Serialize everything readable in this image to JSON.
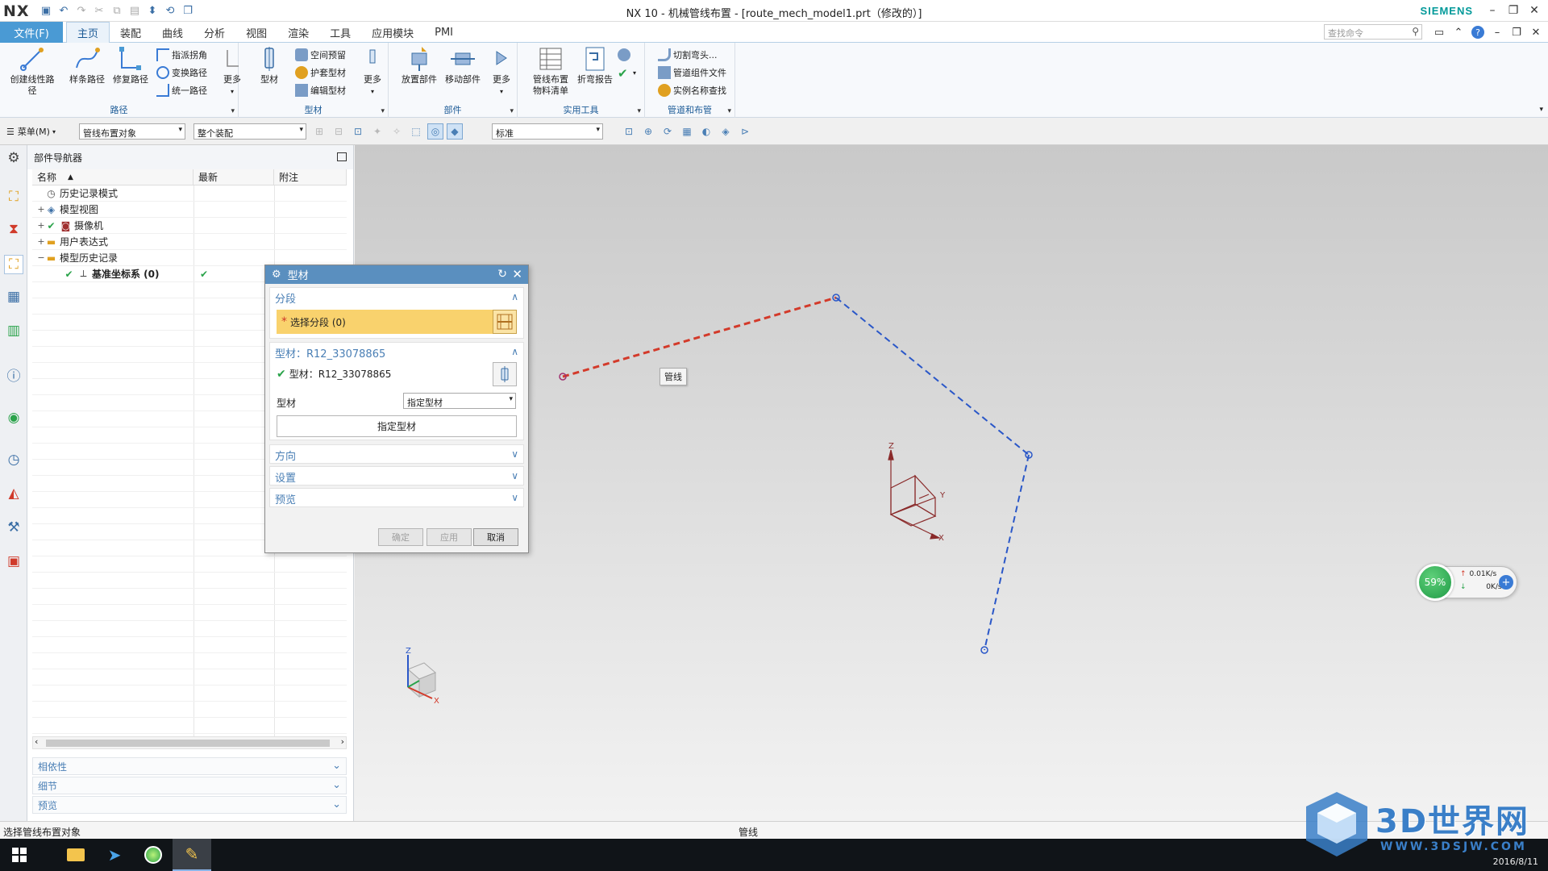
{
  "window": {
    "title": "NX 10 - 机械管线布置 - [route_mech_model1.prt（修改的）]",
    "brand": "SIEMENS",
    "app_logo": "NX"
  },
  "menubar": {
    "file_label": "文件(F)",
    "tabs": [
      "主页",
      "装配",
      "曲线",
      "分析",
      "视图",
      "渲染",
      "工具",
      "应用模块",
      "PMI"
    ],
    "active_tab": "主页",
    "search_placeholder": "查找命令"
  },
  "ribbon": {
    "groups": [
      {
        "name": "路径",
        "big": [
          "创建线性路径",
          "样条路径",
          "修复路径"
        ],
        "small": [
          "指派拐角",
          "变换路径",
          "统一路径"
        ],
        "more": "更多"
      },
      {
        "name": "型材",
        "big": [
          "型材"
        ],
        "small": [
          "空间预留",
          "护套型材",
          "编辑型材"
        ],
        "more": "更多"
      },
      {
        "name": "部件",
        "big": [
          "放置部件",
          "移动部件"
        ],
        "more": "更多"
      },
      {
        "name": "实用工具",
        "big": [
          "管线布置物料清单",
          "折弯报告"
        ]
      },
      {
        "name": "管道和布管",
        "small": [
          "切割弯头...",
          "管道组件文件",
          "实例名称查找"
        ]
      }
    ]
  },
  "selection_bar": {
    "menu_label": "菜单(M)",
    "filter": "管线布置对象",
    "scope": "整个装配",
    "render_style": "标准"
  },
  "navigator": {
    "title": "部件导航器",
    "columns": [
      "名称",
      "最新",
      "附注"
    ],
    "rows": [
      {
        "name": "历史记录模式",
        "icon": "clock-icon",
        "expand": "",
        "latest": ""
      },
      {
        "name": "模型视图",
        "icon": "model-views-icon",
        "expand": "+",
        "latest": ""
      },
      {
        "name": "摄像机",
        "icon": "camera-icon",
        "expand": "+",
        "latest": ""
      },
      {
        "name": "用户表达式",
        "icon": "folder-icon",
        "expand": "+",
        "latest": ""
      },
      {
        "name": "模型历史记录",
        "icon": "folder-icon",
        "expand": "−",
        "latest": ""
      },
      {
        "name": "基准坐标系 (0)",
        "icon": "datum-csys-icon",
        "expand": "",
        "latest": "✔"
      }
    ],
    "panels": [
      "相依性",
      "细节",
      "预览"
    ]
  },
  "dialog": {
    "title": "型材",
    "sections": {
      "segment": {
        "header": "分段",
        "select_label": "选择分段 (0)"
      },
      "profile": {
        "header": "型材：R12_33078865",
        "status_label": "型材：R12_33078865",
        "field_label": "型材",
        "field_value": "指定型材",
        "button_label": "指定型材"
      },
      "direction": {
        "header": "方向"
      },
      "settings": {
        "header": "设置"
      },
      "preview": {
        "header": "预览"
      }
    },
    "buttons": {
      "ok": "确定",
      "apply": "应用",
      "cancel": "取消"
    }
  },
  "graphics": {
    "tooltip": "管线",
    "csys_labels": {
      "z": "Z",
      "y": "Y",
      "x": "X"
    },
    "colors": {
      "selected_segment": "#d33a2a",
      "segment": "#2a57c8",
      "csys": "#8a2a2a"
    }
  },
  "net_widget": {
    "percent": "59%",
    "up": "0.01K/s",
    "down": "0K/s"
  },
  "status": {
    "prompt": "选择管线布置对象",
    "message": "管线"
  },
  "taskbar": {
    "date": "2016/8/11"
  },
  "watermark": {
    "text": "3D世界网",
    "url": "WWW.3DSJW.COM"
  }
}
